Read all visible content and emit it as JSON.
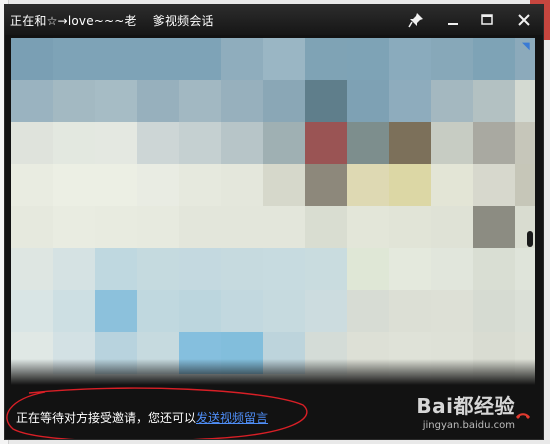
{
  "window": {
    "title_part1": "正在和☆→love~~~老",
    "title_part2": "爹视频会话",
    "buttons": {
      "pin_icon": "pin-icon",
      "minimize_icon": "minimize-icon",
      "maximize_icon": "maximize-icon",
      "close_icon": "close-icon"
    }
  },
  "video": {
    "state": "pixelated-preview"
  },
  "status": {
    "message": "正在等待对方接受邀请，您还可以",
    "link": "发送视频留言"
  },
  "watermark": {
    "brand": "Bai都经验",
    "sub": "jingyan.baidu.com"
  },
  "colors": {
    "title_bg": "#1a1a1a",
    "link": "#4f8ef7",
    "annotation": "#d81f26"
  }
}
